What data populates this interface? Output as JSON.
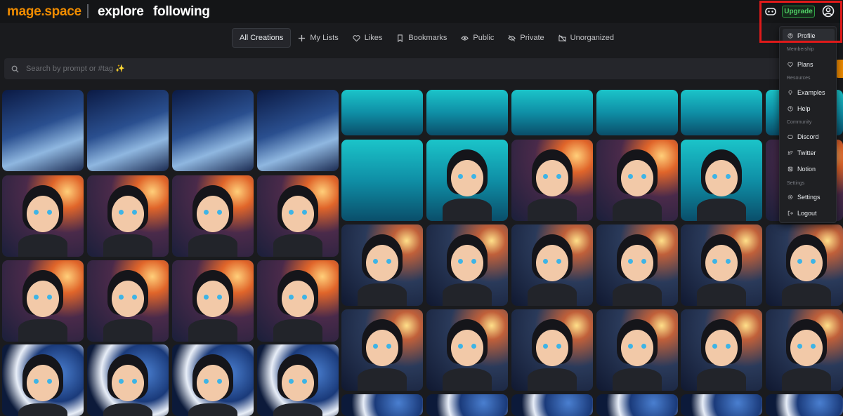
{
  "header": {
    "brand": "mage.space",
    "nav": [
      "explore",
      "following"
    ],
    "upgrade_label": "Upgrade",
    "icons": {
      "discord": "gamepad-icon",
      "account": "user-circle-icon"
    }
  },
  "tabs": [
    {
      "label": "All Creations",
      "active": true,
      "icon": ""
    },
    {
      "label": "My Lists",
      "active": false,
      "icon": "plus-icon"
    },
    {
      "label": "Likes",
      "active": false,
      "icon": "heart-icon"
    },
    {
      "label": "Bookmarks",
      "active": false,
      "icon": "bookmark-icon"
    },
    {
      "label": "Public",
      "active": false,
      "icon": "eye-icon"
    },
    {
      "label": "Private",
      "active": false,
      "icon": "eye-off-icon"
    },
    {
      "label": "Unorganized",
      "active": false,
      "icon": "folder-off-icon"
    }
  ],
  "search": {
    "placeholder": "Search by prompt or #tag ✨"
  },
  "menu": {
    "items": [
      {
        "label": "Profile",
        "icon": "user-icon"
      },
      {
        "label": "Plans",
        "icon": "heart-icon"
      },
      {
        "label": "Examples",
        "icon": "bulb-icon"
      },
      {
        "label": "Help",
        "icon": "help-circle-icon"
      },
      {
        "label": "Discord",
        "icon": "discord-icon"
      },
      {
        "label": "Twitter",
        "icon": "twitter-icon"
      },
      {
        "label": "Notion",
        "icon": "notion-icon"
      },
      {
        "label": "Settings",
        "icon": "settings-icon"
      },
      {
        "label": "Logout",
        "icon": "logout-icon"
      }
    ],
    "sections": [
      "Membership",
      "Resources",
      "Community",
      "Settings"
    ]
  },
  "colors": {
    "brand": "#f08c00",
    "upgrade": "#51cf66",
    "highlight": "#e01a1a",
    "bg": "#1a1b1e"
  }
}
